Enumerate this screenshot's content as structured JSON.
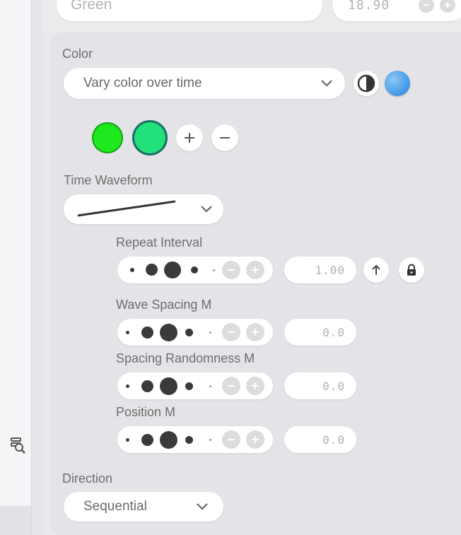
{
  "header": {
    "name_value": "Green",
    "size_value": "18.90"
  },
  "color_section": {
    "label": "Color",
    "mode": "Vary color over time",
    "swatches": [
      "#1ee81e",
      "#22e07a"
    ]
  },
  "waveform_section": {
    "label": "Time Waveform"
  },
  "params": [
    {
      "label": "Repeat Interval",
      "value": "1.00"
    },
    {
      "label": "Wave Spacing M",
      "value": "0.0"
    },
    {
      "label": "Spacing Randomness M",
      "value": "0.0"
    },
    {
      "label": "Position M",
      "value": "0.0"
    }
  ],
  "direction_section": {
    "label": "Direction",
    "value": "Sequential"
  },
  "colors": {
    "panel_bg": "#e4e3e7",
    "accent_blue": "#4a9ee8"
  }
}
